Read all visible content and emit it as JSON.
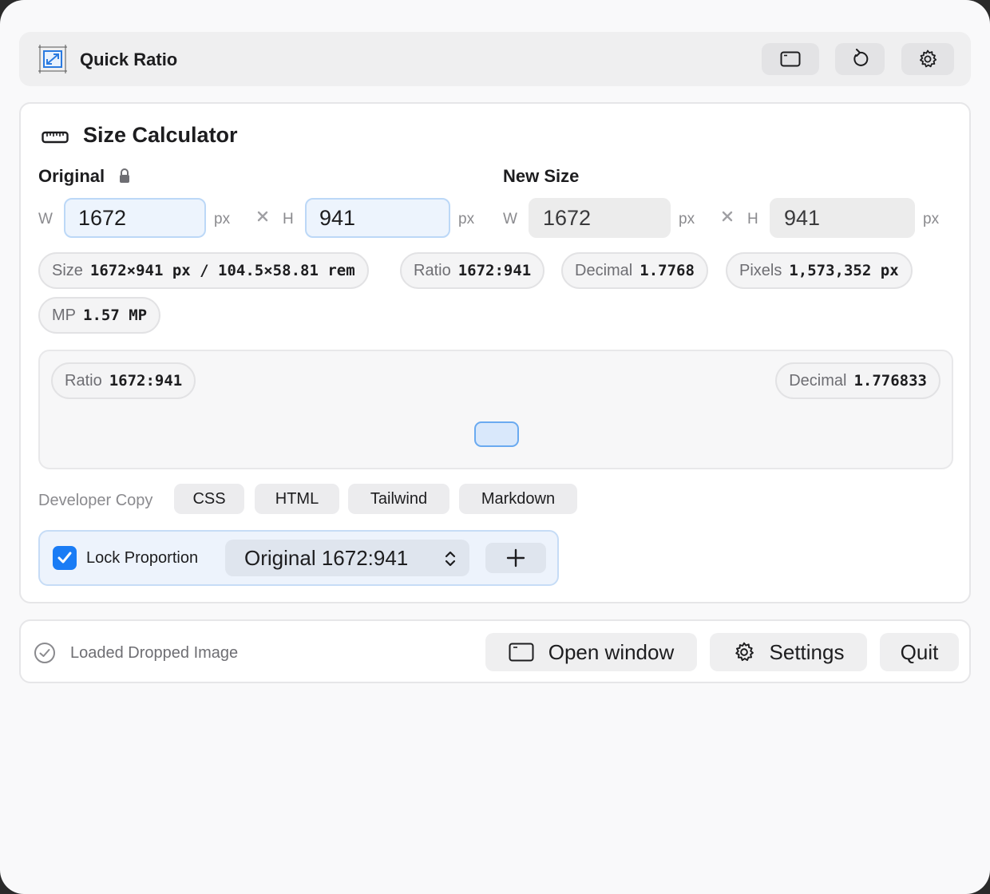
{
  "header": {
    "title": "Quick Ratio",
    "icons": [
      "resize-app-icon",
      "window-icon",
      "reset-icon",
      "gear-icon"
    ]
  },
  "calculator": {
    "title": "Size Calculator",
    "original": {
      "label": "Original",
      "w_label": "W",
      "h_label": "H",
      "width": "1672",
      "height": "941",
      "unit": "px"
    },
    "new_size": {
      "label": "New Size",
      "w_label": "W",
      "h_label": "H",
      "width": "1672",
      "height": "941",
      "unit": "px"
    },
    "stats": [
      {
        "key": "Size",
        "value": "1672×941 px / 104.5×58.81 rem"
      },
      {
        "key": "Ratio",
        "value": "1672:941"
      },
      {
        "key": "Decimal",
        "value": "1.7768"
      },
      {
        "key": "Pixels",
        "value": "1,573,352 px"
      },
      {
        "key": "MP",
        "value": "1.57 MP"
      }
    ],
    "preview": {
      "ratio_key": "Ratio",
      "ratio_value": "1672:941",
      "decimal_key": "Decimal",
      "decimal_value": "1.776833"
    },
    "developer_copy": {
      "label": "Developer Copy",
      "buttons": [
        "CSS",
        "HTML",
        "Tailwind",
        "Markdown"
      ]
    },
    "lock": {
      "checked": true,
      "label": "Lock Proportion",
      "preset": "Original 1672:941"
    }
  },
  "footer": {
    "status": "Loaded Dropped Image",
    "open_window": "Open window",
    "settings": "Settings",
    "quit": "Quit"
  },
  "colors": {
    "accent": "#1a7cf5",
    "window_bg": "#f9f9fa"
  }
}
